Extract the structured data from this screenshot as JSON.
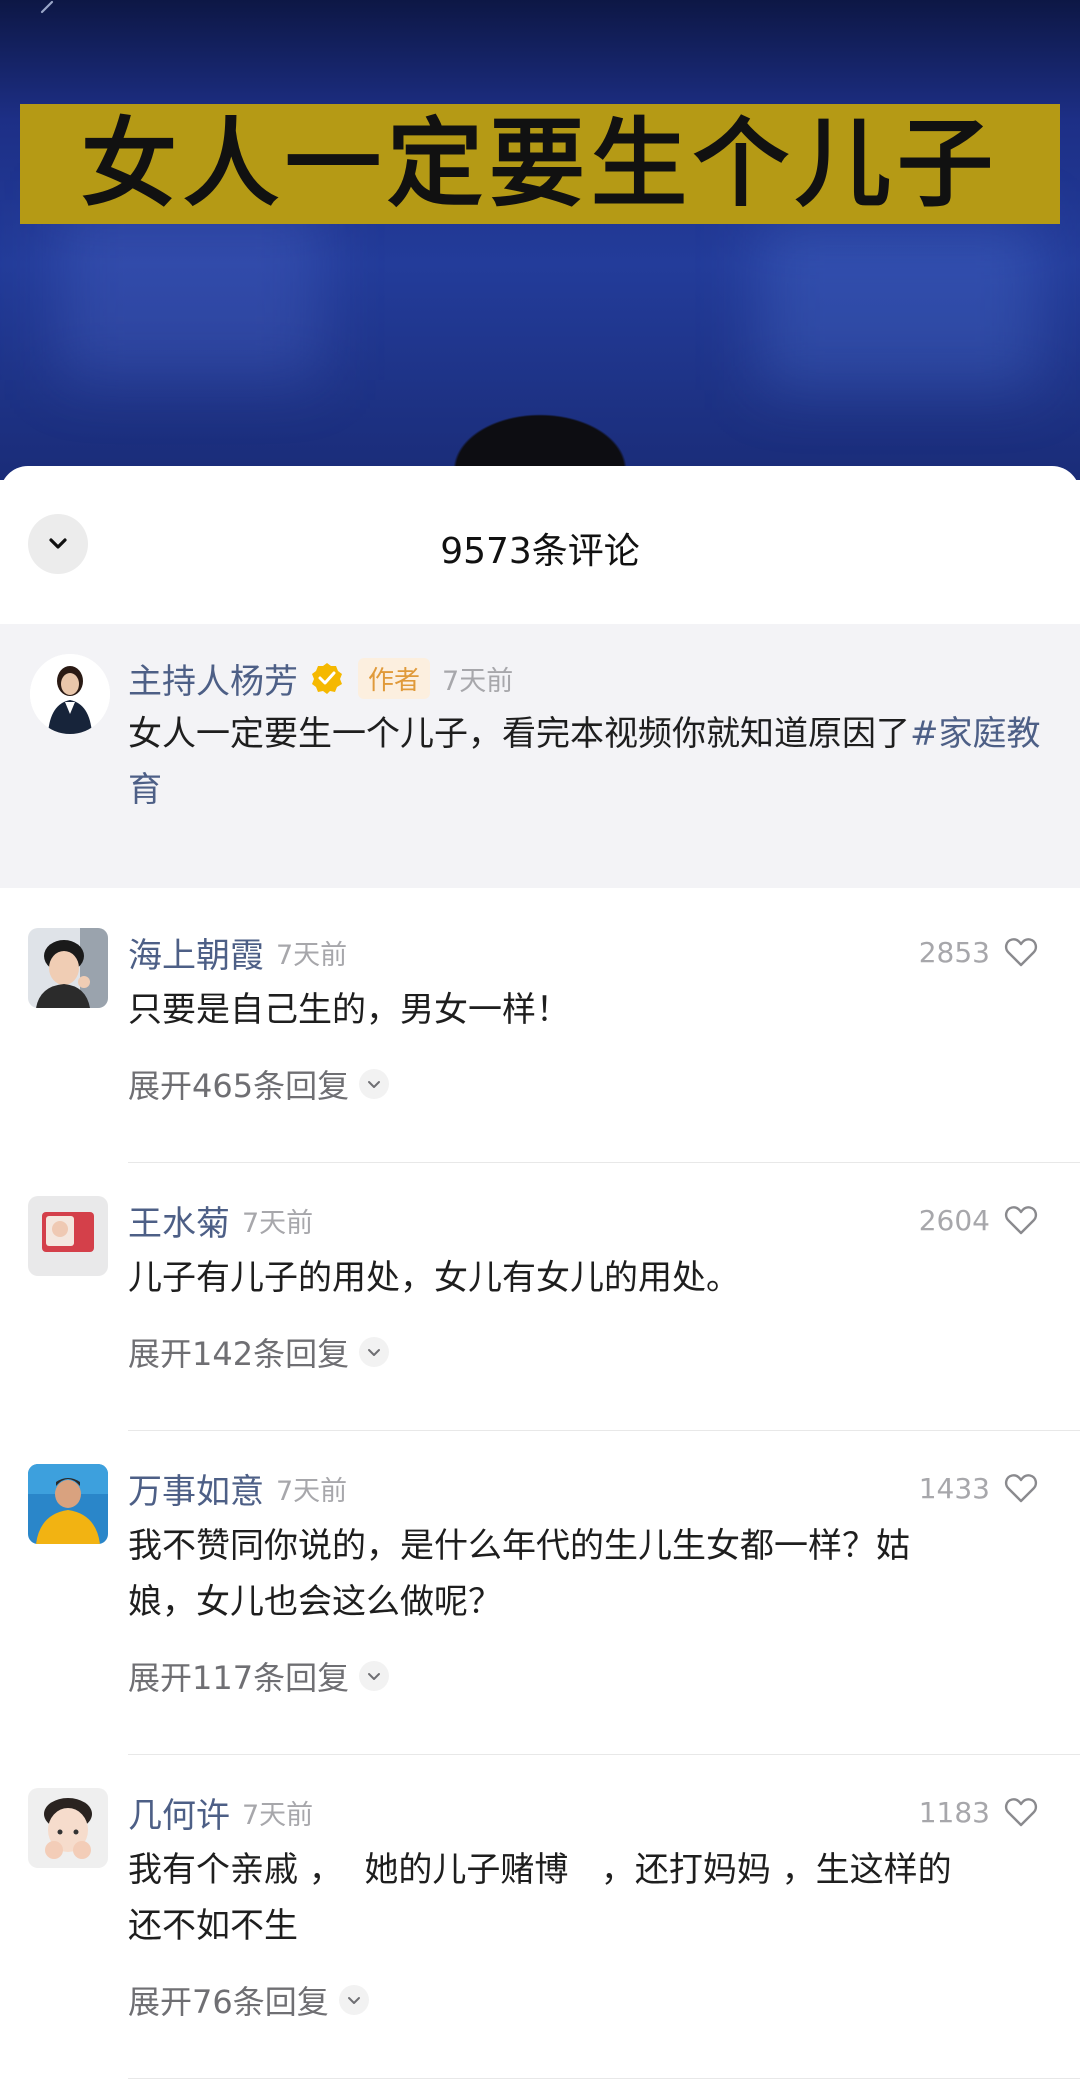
{
  "video": {
    "banner_text": "女人一定要生个儿子"
  },
  "sheet": {
    "title": "9573条评论"
  },
  "author_post": {
    "name": "主持人杨芳",
    "tag": "作者",
    "time": "7天前",
    "text": "女人一定要生一个儿子，看完本视频你就知道原因了",
    "hashtag": "#家庭教育"
  },
  "comments": [
    {
      "name": "海上朝霞",
      "time": "7天前",
      "likes": "2853",
      "text": "只要是自己生的，男女一样！",
      "replies": "展开465条回复"
    },
    {
      "name": "王水菊",
      "time": "7天前",
      "likes": "2604",
      "text": "儿子有儿子的用处，女儿有女儿的用处。",
      "replies": "展开142条回复"
    },
    {
      "name": "万事如意",
      "time": "7天前",
      "likes": "1433",
      "text": "我不赞同你说的，是什么年代的生儿生女都一样？姑娘，女儿也会这么做呢？",
      "replies": "展开117条回复"
    },
    {
      "name": "几何许",
      "time": "7天前",
      "likes": "1183",
      "text": "我有个亲戚 ，  她的儿子赌博   ，还打妈妈 ，生这样的还不如不生",
      "replies": "展开76条回复"
    }
  ],
  "colors": {
    "name_link": "#4d5f86",
    "author_tag": "#e09a3a",
    "banner": "#b59a15"
  }
}
